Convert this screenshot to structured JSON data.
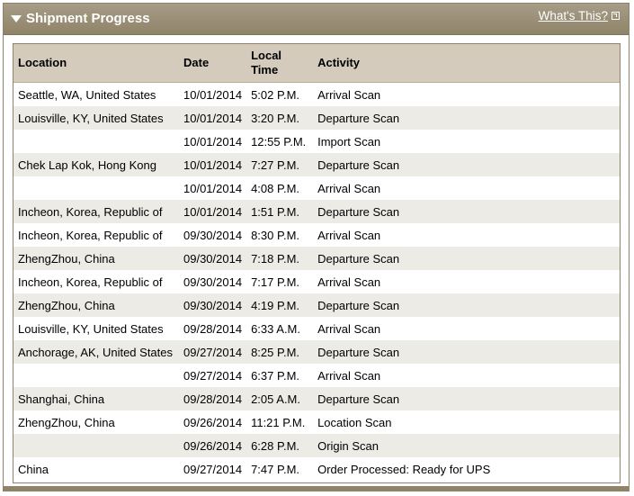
{
  "header": {
    "title": "Shipment Progress",
    "whats_this_label": "What's This?"
  },
  "table": {
    "columns": [
      "Location",
      "Date",
      "Local Time",
      "Activity"
    ],
    "rows": [
      {
        "location": "Seattle, WA, United States",
        "date": "10/01/2014",
        "time": "5:02 P.M.",
        "activity": "Arrival Scan"
      },
      {
        "location": "Louisville, KY, United States",
        "date": "10/01/2014",
        "time": "3:20 P.M.",
        "activity": "Departure Scan"
      },
      {
        "location": "",
        "date": "10/01/2014",
        "time": "12:55 P.M.",
        "activity": "Import Scan"
      },
      {
        "location": "Chek Lap Kok, Hong Kong",
        "date": "10/01/2014",
        "time": "7:27 P.M.",
        "activity": "Departure Scan"
      },
      {
        "location": "",
        "date": "10/01/2014",
        "time": "4:08 P.M.",
        "activity": "Arrival Scan"
      },
      {
        "location": "Incheon, Korea, Republic of",
        "date": "10/01/2014",
        "time": "1:51 P.M.",
        "activity": "Departure Scan"
      },
      {
        "location": "Incheon, Korea, Republic of",
        "date": "09/30/2014",
        "time": "8:30 P.M.",
        "activity": "Arrival Scan"
      },
      {
        "location": "ZhengZhou, China",
        "date": "09/30/2014",
        "time": "7:18 P.M.",
        "activity": "Departure Scan"
      },
      {
        "location": "Incheon, Korea, Republic of",
        "date": "09/30/2014",
        "time": "7:17 P.M.",
        "activity": "Arrival Scan"
      },
      {
        "location": "ZhengZhou, China",
        "date": "09/30/2014",
        "time": "4:19 P.M.",
        "activity": "Departure Scan"
      },
      {
        "location": "Louisville, KY, United States",
        "date": "09/28/2014",
        "time": "6:33 A.M.",
        "activity": "Arrival Scan"
      },
      {
        "location": "Anchorage, AK, United States",
        "date": "09/27/2014",
        "time": "8:25 P.M.",
        "activity": "Departure Scan"
      },
      {
        "location": "",
        "date": "09/27/2014",
        "time": "6:37 P.M.",
        "activity": "Arrival Scan"
      },
      {
        "location": "Shanghai, China",
        "date": "09/28/2014",
        "time": "2:05 A.M.",
        "activity": "Departure Scan"
      },
      {
        "location": "ZhengZhou, China",
        "date": "09/26/2014",
        "time": "11:21 P.M.",
        "activity": "Location Scan"
      },
      {
        "location": "",
        "date": "09/26/2014",
        "time": "6:28 P.M.",
        "activity": "Origin Scan"
      },
      {
        "location": "China",
        "date": "09/27/2014",
        "time": "7:47 P.M.",
        "activity": "Order Processed: Ready for UPS"
      }
    ]
  }
}
